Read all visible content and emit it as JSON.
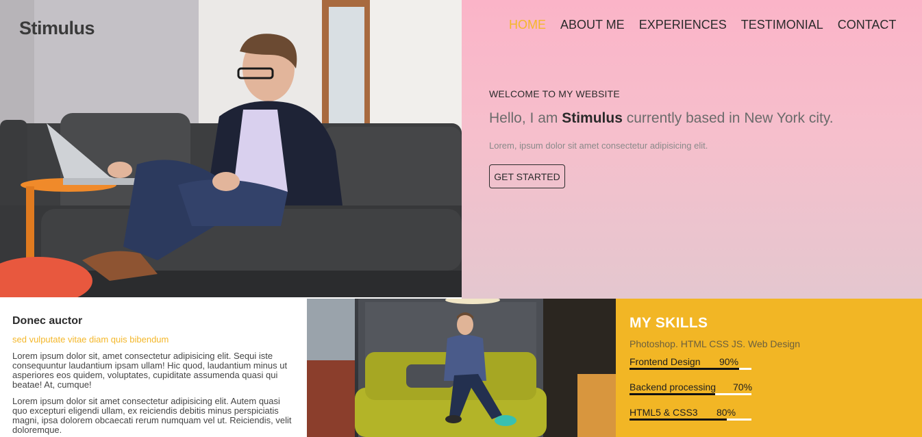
{
  "brand": {
    "logo": "Stimulus"
  },
  "nav": {
    "items": [
      {
        "label": "HOME",
        "active": true
      },
      {
        "label": "ABOUT ME",
        "active": false
      },
      {
        "label": "EXPERIENCES",
        "active": false
      },
      {
        "label": "TESTIMONIAL",
        "active": false
      },
      {
        "label": "CONTACT",
        "active": false
      }
    ]
  },
  "hero": {
    "welcome": "WELCOME TO MY WEBSITE",
    "headline_pre": "Hello, I am ",
    "headline_name": "Stimulus",
    "headline_post": " currently based in New York city.",
    "lead": "Lorem, ipsum dolor sit amet consectetur adipisicing elit.",
    "cta_label": "GET STARTED"
  },
  "article": {
    "title": "Donec auctor",
    "subtitle": "sed vulputate vitae diam quis bibendum",
    "paragraphs": [
      "Lorem ipsum dolor sit, amet consectetur adipisicing elit. Sequi iste consequuntur laudantium ipsam ullam! Hic quod, laudantium minus ut asperiores eos quidem, voluptates, cupiditate assumenda quasi qui beatae! At, cumque!",
      "Lorem ipsum dolor sit amet consectetur adipisicing elit. Autem quasi quo excepturi eligendi ullam, ex reiciendis debitis minus perspiciatis magni, ipsa dolorem obcaecati rerum numquam vel ut. Reiciendis, velit doloremque."
    ]
  },
  "skills": {
    "title": "MY SKILLS",
    "subtitle": "Photoshop. HTML CSS JS. Web Design",
    "items": [
      {
        "name": "Frontend Design",
        "percent": "90%",
        "level": 0.9
      },
      {
        "name": "Backend processing",
        "percent": "70%",
        "level": 0.7
      },
      {
        "name": "HTML5 & CSS3",
        "percent": "80%",
        "level": 0.8
      }
    ]
  },
  "colors": {
    "accent": "#f4b72a",
    "panel_pink": "#fbb4c8",
    "skills_bg": "#f2b625"
  }
}
